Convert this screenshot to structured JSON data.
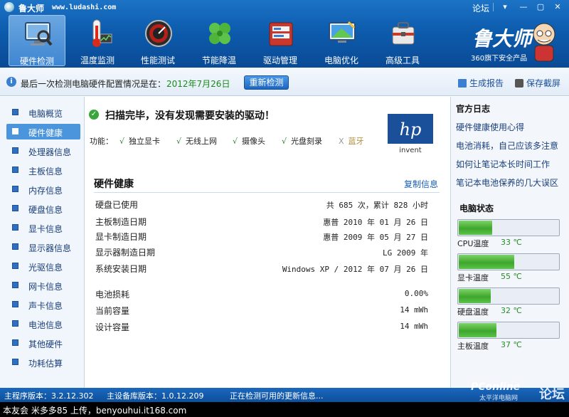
{
  "titlebar": {
    "app_name": "鲁大师",
    "url": "www.ludashi.com",
    "forum": "论坛",
    "menu_icon": "dropdown-icon",
    "min_icon": "minimize-icon",
    "max_icon": "maximize-icon",
    "close_icon": "close-icon"
  },
  "nav": [
    {
      "label": "硬件检测",
      "icon": "monitor-magnifier-icon"
    },
    {
      "label": "温度监测",
      "icon": "thermometer-icon"
    },
    {
      "label": "性能测试",
      "icon": "speedometer-icon"
    },
    {
      "label": "节能降温",
      "icon": "clover-icon"
    },
    {
      "label": "驱动管理",
      "icon": "driver-box-icon"
    },
    {
      "label": "电脑优化",
      "icon": "screen-optimize-icon"
    },
    {
      "label": "高级工具",
      "icon": "toolbox-icon"
    }
  ],
  "brand": {
    "name": "鲁大师",
    "tagline": "360旗下安全产品"
  },
  "infobar": {
    "text": "最后一次检测电脑硬件配置情况是在：",
    "date": "2012年7月26日",
    "recheck_label": "重新检测",
    "report_label": "生成报告",
    "save_label": "保存截屏"
  },
  "sidebar": {
    "items": [
      {
        "label": "电脑概览"
      },
      {
        "label": "硬件健康"
      },
      {
        "label": "处理器信息"
      },
      {
        "label": "主板信息"
      },
      {
        "label": "内存信息"
      },
      {
        "label": "硬盘信息"
      },
      {
        "label": "显卡信息"
      },
      {
        "label": "显示器信息"
      },
      {
        "label": "光驱信息"
      },
      {
        "label": "网卡信息"
      },
      {
        "label": "声卡信息"
      },
      {
        "label": "电池信息"
      },
      {
        "label": "其他硬件"
      },
      {
        "label": "功耗估算"
      }
    ],
    "active_index": 1
  },
  "main": {
    "scan_result": "扫描完毕，没有发现需要安装的驱动！",
    "features_label": "功能：",
    "features": [
      {
        "mark": "√",
        "label": "独立显卡",
        "available": true
      },
      {
        "mark": "√",
        "label": "无线上网",
        "available": true
      },
      {
        "mark": "√",
        "label": "摄像头",
        "available": true
      },
      {
        "mark": "√",
        "label": "光盘刻录",
        "available": true
      },
      {
        "mark": "X",
        "label": "蓝牙",
        "available": false
      }
    ],
    "brand_logo": {
      "text": "hp",
      "sub": "invent"
    },
    "section_title": "硬件健康",
    "copy_label": "复制信息",
    "rows": [
      {
        "label": "硬盘已使用",
        "value": "共 685 次，累计 828 小时"
      },
      {
        "label": "主板制造日期",
        "value": "惠普 2010 年 01 月 26 日"
      },
      {
        "label": "显卡制造日期",
        "value": "惠普 2009 年 05 月 27 日"
      },
      {
        "label": "显示器制造日期",
        "value": "LG 2009 年"
      },
      {
        "label": "系统安装日期",
        "value": "Windows XP / 2012 年 07 月 26 日"
      },
      {
        "label": "电池损耗",
        "value": "0.00%"
      },
      {
        "label": "当前容量",
        "value": "14 mWh"
      },
      {
        "label": "设计容量",
        "value": "14 mWh"
      }
    ]
  },
  "rightpanel": {
    "log_title": "官方日志",
    "log_links": [
      "硬件健康使用心得",
      "电池消耗，自己应该多注意",
      "如何让笔记本长时间工作",
      "笔记本电池保养的几大误区"
    ],
    "status_title": "电脑状态",
    "temps": [
      {
        "label": "CPU温度",
        "value": "33 ℃",
        "level": 0.33
      },
      {
        "label": "显卡温度",
        "value": "55 ℃",
        "level": 0.55
      },
      {
        "label": "硬盘温度",
        "value": "32 ℃",
        "level": 0.32
      },
      {
        "label": "主板温度",
        "value": "37 ℃",
        "level": 0.37
      }
    ]
  },
  "statusbar": {
    "main_version": "主程序版本：3.2.12.302",
    "db_version": "主设备库版本：1.0.12.209",
    "update_text": "正在检测可用的更新信息..."
  },
  "watermark": {
    "site": "PConline",
    "sub": "太平洋电脑网",
    "forum": "论坛"
  },
  "footer": {
    "text": "本友会 米多多85 上传，benyouhui.it168.com"
  }
}
